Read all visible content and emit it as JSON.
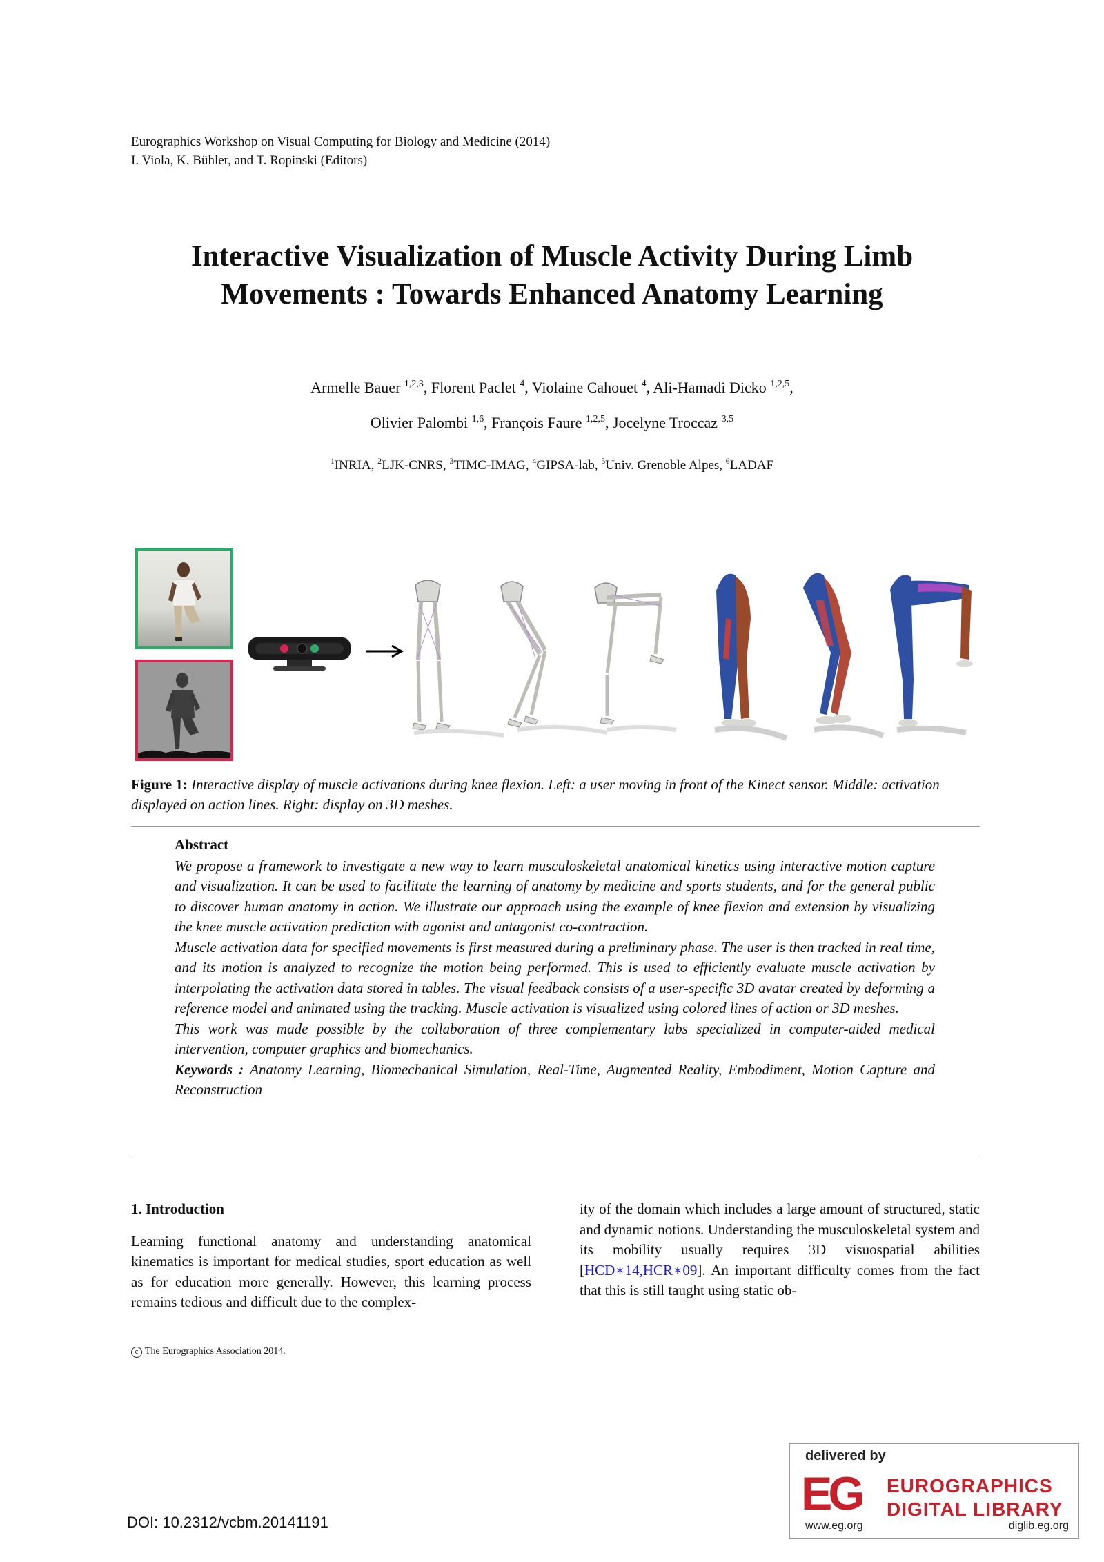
{
  "header": {
    "line1": "Eurographics Workshop on Visual Computing for Biology and Medicine (2014)",
    "line2": "I. Viola, K. Bühler, and T. Ropinski (Editors)"
  },
  "title": {
    "line1": "Interactive Visualization of Muscle Activity During Limb",
    "line2": "Movements : Towards Enhanced Anatomy Learning"
  },
  "authors": [
    {
      "name": "Armelle Bauer",
      "sup": "1,2,3",
      "sep": ", "
    },
    {
      "name": "Florent Paclet",
      "sup": "4",
      "sep": ", "
    },
    {
      "name": "Violaine Cahouet",
      "sup": "4",
      "sep": ", "
    },
    {
      "name": "Ali-Hamadi Dicko",
      "sup": "1,2,5",
      "sep": ","
    },
    {
      "name": "Olivier Palombi",
      "sup": "1,6",
      "sep": ", "
    },
    {
      "name": "François Faure",
      "sup": "1,2,5",
      "sep": ", "
    },
    {
      "name": "Jocelyne Troccaz",
      "sup": "3,5",
      "sep": ""
    }
  ],
  "affiliations": [
    {
      "sup": "1",
      "name": "INRIA",
      "sep": ", "
    },
    {
      "sup": "2",
      "name": "LJK-CNRS",
      "sep": ", "
    },
    {
      "sup": "3",
      "name": "TIMC-IMAG",
      "sep": ", "
    },
    {
      "sup": "4",
      "name": "GIPSA-lab",
      "sep": ", "
    },
    {
      "sup": "5",
      "name": "Univ. Grenoble Alpes",
      "sep": ", "
    },
    {
      "sup": "6",
      "name": "LADAF",
      "sep": ""
    }
  ],
  "figure": {
    "label": "Figure 1:",
    "caption": "Interactive display of muscle activations during knee flexion. Left: a user moving in front of the Kinect sensor. Middle: activation displayed on action lines. Right: display on 3D meshes.",
    "colors": {
      "rgb_frame": "#2fa86a",
      "depth_frame": "#d6264f",
      "arrow": "#000000"
    }
  },
  "abstract": {
    "heading": "Abstract",
    "paragraphs": [
      "We propose a framework to investigate a new way to learn musculoskeletal anatomical kinetics using interactive motion capture and visualization. It can be used to facilitate the learning of anatomy by medicine and sports students, and for the general public to discover human anatomy in action. We illustrate our approach using the example of knee flexion and extension by visualizing the knee muscle activation prediction with agonist and antagonist co-contraction.",
      "Muscle activation data for specified movements is first measured during a preliminary phase. The user is then tracked in real time, and its motion is analyzed to recognize the motion being performed. This is used to efficiently evaluate muscle activation by interpolating the activation data stored in tables. The visual feedback consists of a user-specific 3D avatar created by deforming a reference model and animated using the tracking. Muscle activation is visualized using colored lines of action or 3D meshes.",
      "This work was made possible by the collaboration of three complementary labs specialized in computer-aided medical intervention, computer graphics and biomechanics."
    ],
    "keywords_label": "Keywords :",
    "keywords": "Anatomy Learning, Biomechanical Simulation, Real-Time, Augmented Reality, Embodiment, Motion Capture and Reconstruction"
  },
  "intro": {
    "heading": "1.  Introduction",
    "left_text": "Learning functional anatomy and understanding anatomical kinematics is important for medical studies, sport education as well as for education more generally. However, this learning process remains tedious and difficult due to the complex-",
    "right_text_before": "ity of the domain which includes a large amount of structured, static and dynamic notions. Understanding the musculoskeletal system and its mobility usually requires 3D visuospatial abilities [",
    "cite1": "HCD∗14",
    "cite_sep": ",",
    "cite2": "HCR∗09",
    "right_text_after": "]. An important difficulty comes from the fact that this is still taught using static ob-"
  },
  "footer": {
    "copyright_symbol": "c",
    "copyright": "The Eurographics Association 2014.",
    "doi": "DOI: 10.2312/vcbm.20141191"
  },
  "eg_badge": {
    "delivered_by": "delivered by",
    "logo": "EG",
    "name_line1": "EUROGRAPHICS",
    "name_line2": "DIGITAL LIBRARY",
    "www": "www.eg.org",
    "url": "diglib.eg.org"
  }
}
